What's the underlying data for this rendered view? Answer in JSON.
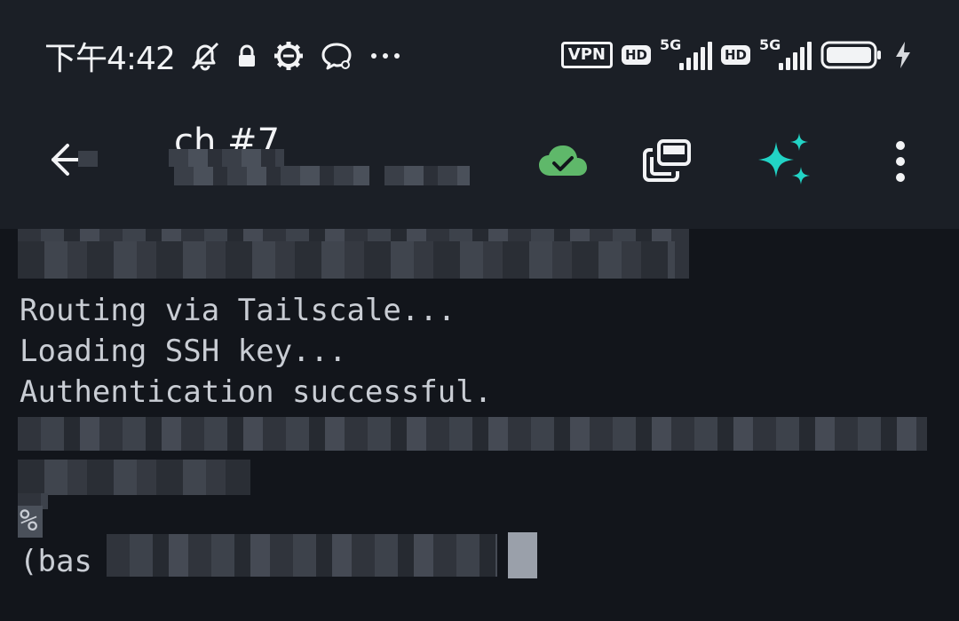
{
  "status_bar": {
    "time": "下午4:42",
    "vpn": "VPN",
    "hd1": "HD",
    "net1": "5G",
    "hd2": "HD",
    "net2": "5G"
  },
  "header": {
    "title": "ch #7"
  },
  "icons": {
    "back": "arrow-left-icon",
    "sync": "cloud-check-icon",
    "windows": "stacked-windows-icon",
    "ai": "sparkle-icon",
    "more": "more-vertical-icon"
  },
  "colors": {
    "sync_green": "#5fb86a",
    "ai_teal": "#22d3c5"
  },
  "terminal": {
    "lines": [
      "Routing via Tailscale...",
      "Loading SSH key...",
      "Authentication successful."
    ],
    "prompt_symbol": "%",
    "prompt_prefix": "(bas"
  }
}
